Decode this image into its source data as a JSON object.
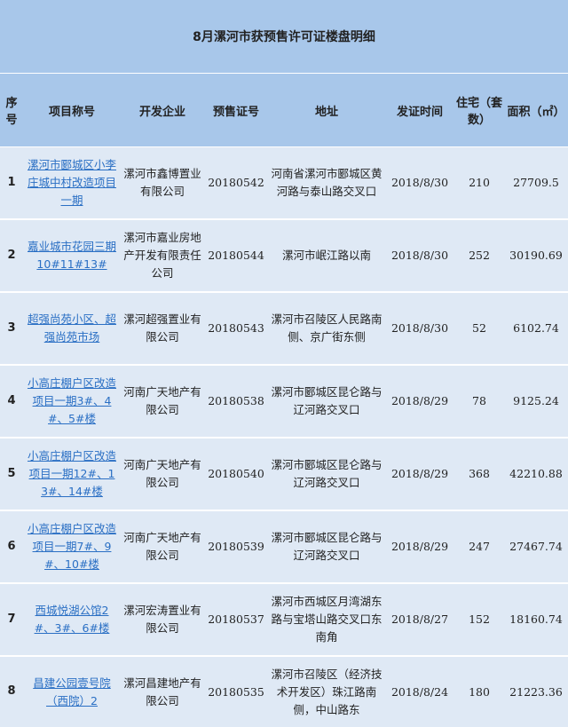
{
  "title": "8月漯河市获预售许可证楼盘明细",
  "headers": {
    "idx": "序号",
    "name": "项目称号",
    "dev": "开发企业",
    "permit": "预售证号",
    "addr": "地址",
    "date": "发证时间",
    "units": "住宅（套数）",
    "area": "面积（㎡）"
  },
  "rows": [
    {
      "idx": "1",
      "name": "漯河市郾城区小李庄城中村改造项目一期",
      "dev": "漯河市鑫博置业有限公司",
      "permit": "20180542",
      "addr": "河南省漯河市郾城区黄河路与泰山路交叉口",
      "date": "2018/8/30",
      "units": "210",
      "area": "27709.5"
    },
    {
      "idx": "2",
      "name": "嘉业城市花园三期10#11#13#",
      "dev": "漯河市嘉业房地产开发有限责任公司",
      "permit": "20180544",
      "addr": "漯河市岷江路以南",
      "date": "2018/8/30",
      "units": "252",
      "area": "30190.69"
    },
    {
      "idx": "3",
      "name": "超强尚苑小区、超强尚苑市场",
      "dev": "漯河超强置业有限公司",
      "permit": "20180543",
      "addr": "漯河市召陵区人民路南侧、京广街东侧",
      "date": "2018/8/30",
      "units": "52",
      "area": "6102.74"
    },
    {
      "idx": "4",
      "name": "小高庄棚户区改造项目一期3#、4#、5#楼",
      "dev": "河南广天地产有限公司",
      "permit": "20180538",
      "addr": "漯河市郾城区昆仑路与辽河路交叉口",
      "date": "2018/8/29",
      "units": "78",
      "area": "9125.24"
    },
    {
      "idx": "5",
      "name": "小高庄棚户区改造项目一期12#、13#、14#楼",
      "dev": "河南广天地产有限公司",
      "permit": "20180540",
      "addr": "漯河市郾城区昆仑路与辽河路交叉口",
      "date": "2018/8/29",
      "units": "368",
      "area": "42210.88"
    },
    {
      "idx": "6",
      "name": "小高庄棚户区改造项目一期7#、9#、10#楼",
      "dev": "河南广天地产有限公司",
      "permit": "20180539",
      "addr": "漯河市郾城区昆仑路与辽河路交叉口",
      "date": "2018/8/29",
      "units": "247",
      "area": "27467.74"
    },
    {
      "idx": "7",
      "name": "西城悦湖公馆2#、3#、6#楼",
      "dev": "漯河宏涛置业有限公司",
      "permit": "20180537",
      "addr": "漯河市西城区月湾湖东路与宝塔山路交叉口东南角",
      "date": "2018/8/27",
      "units": "152",
      "area": "18160.74"
    },
    {
      "idx": "8",
      "name": "昌建公园壹号院（西院）2",
      "dev": "漯河昌建地产有限公司",
      "permit": "20180535",
      "addr": "漯河市召陵区（经济技术开发区）珠江路南侧，中山路东",
      "date": "2018/8/24",
      "units": "180",
      "area": "21223.36"
    }
  ]
}
